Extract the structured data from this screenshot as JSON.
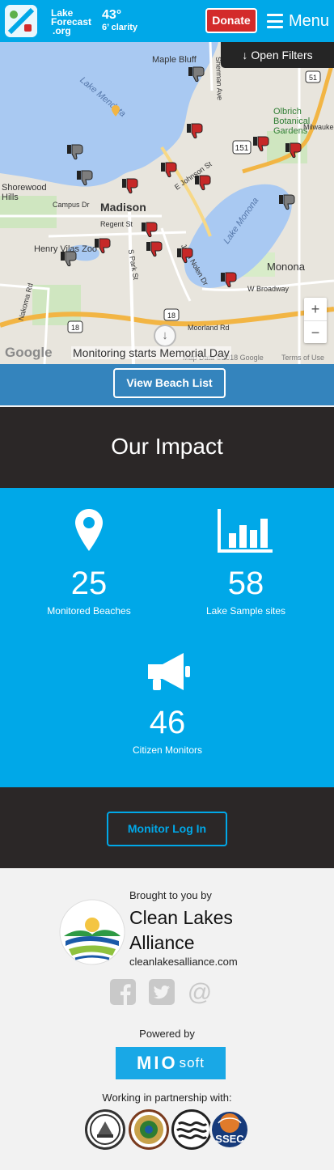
{
  "header": {
    "logo_lines": [
      "Lake",
      "Forecast",
      ".org"
    ],
    "temperature": "43°",
    "clarity": "6’ clarity",
    "donate_label": "Donate",
    "menu_label": "Menu"
  },
  "map": {
    "filters_label": "Open Filters",
    "places": [
      "Maple Bluff",
      "Lake Mendota",
      "Olbrich Botanical Gardens",
      "Shorewood Hills",
      "Madison",
      "Campus Dr",
      "Regent St",
      "Henry Vilas Zoo",
      "Lake Monona",
      "Monona",
      "E Johnson St",
      "John Nolen Dr",
      "S Park St",
      "W Broadway",
      "Moorland Rd",
      "Nakoma Rd",
      "Milwaukee",
      "Sherman Ave"
    ],
    "monitoring_note": "Monitoring starts Memorial Day",
    "google_label": "Google",
    "map_data_label": "Map Data ©2018 Google",
    "terms_label": "Terms of Use",
    "zoom_in": "+",
    "zoom_out": "−",
    "route_labels": [
      "151",
      "18",
      "18",
      "51"
    ]
  },
  "beach_list_label": "View Beach List",
  "impact": {
    "title": "Our Impact",
    "stats": [
      {
        "value": "25",
        "label": "Monitored Beaches",
        "icon": "map-pin-icon"
      },
      {
        "value": "58",
        "label": "Lake Sample sites",
        "icon": "bar-chart-icon"
      },
      {
        "value": "46",
        "label": "Citizen Monitors",
        "icon": "megaphone-icon"
      }
    ]
  },
  "monitor_login_label": "Monitor Log In",
  "footer": {
    "brought_by": "Brought to you by",
    "org_name": "Clean Lakes Alliance",
    "org_url": "cleanlakesalliance.com",
    "social_icons": [
      "facebook-icon",
      "twitter-icon",
      "email-at-icon"
    ],
    "powered_by": "Powered by",
    "mio_bold": "MIO",
    "mio_light": "soft",
    "partnership": "Working in partnership with:",
    "partner_seals": [
      "city-of-madison-seal",
      "county-of-dane-seal",
      "water-waves-seal",
      "ssec-seal"
    ],
    "ssec_label": "SSEC"
  },
  "colors": {
    "brand_blue": "#00a8e8",
    "donate_red": "#d32b2b",
    "dark_band": "#2b2727",
    "beach_strip": "#3484bd"
  }
}
